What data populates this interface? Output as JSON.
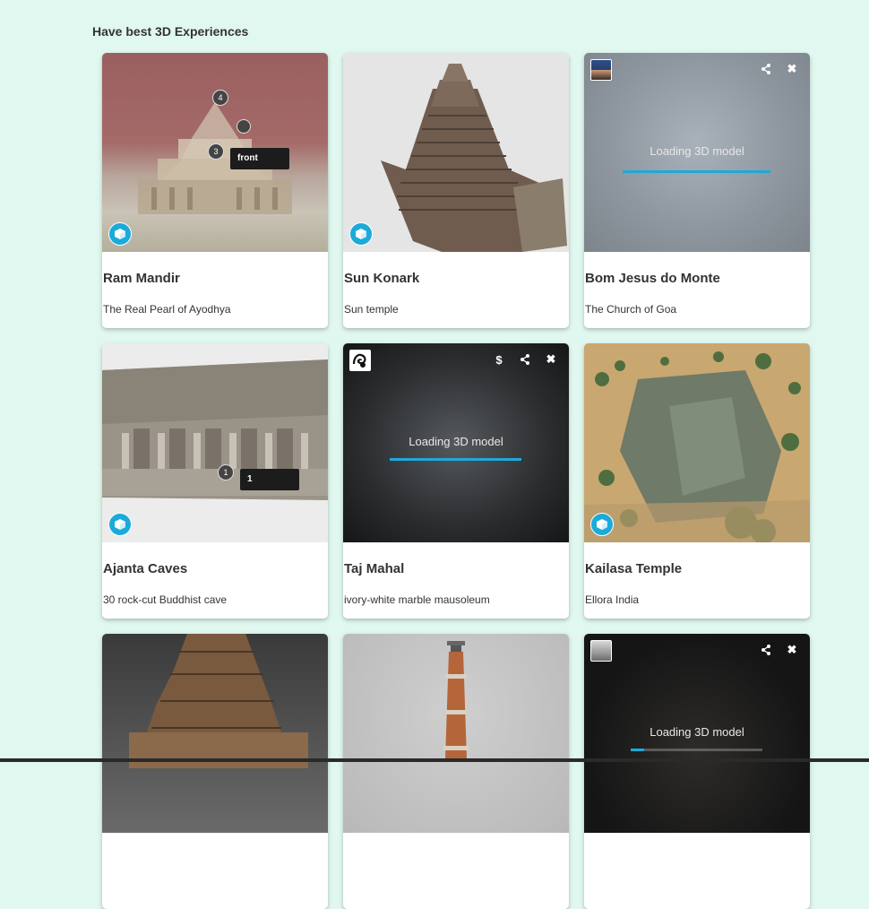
{
  "section": {
    "title": "Have best 3D Experiences"
  },
  "loading_label": "Loading 3D model",
  "colors": {
    "background": "#e0f8ef",
    "accent": "#1caad9"
  },
  "cards": [
    {
      "title": "Ram Mandir",
      "subtitle": "The Real Pearl of Ayodhya",
      "hotspots": [
        "4",
        "3"
      ],
      "annotation": "front"
    },
    {
      "title": "Sun Konark",
      "subtitle": "Sun temple"
    },
    {
      "title": "Bom Jesus do Monte",
      "subtitle": "The Church of Goa",
      "loading_progress": 1.0
    },
    {
      "title": "Ajanta Caves",
      "subtitle": "30 rock-cut Buddhist cave",
      "hotspots": [
        "1"
      ],
      "annotation": "1"
    },
    {
      "title": "Taj Mahal",
      "subtitle": "ivory-white marble mausoleum",
      "loading_progress": 1.0
    },
    {
      "title": "Kailasa Temple",
      "subtitle": "Ellora India"
    },
    {
      "title": "",
      "subtitle": ""
    },
    {
      "title": "",
      "subtitle": ""
    },
    {
      "title": "",
      "subtitle": "",
      "loading_progress": 0.1
    }
  ]
}
